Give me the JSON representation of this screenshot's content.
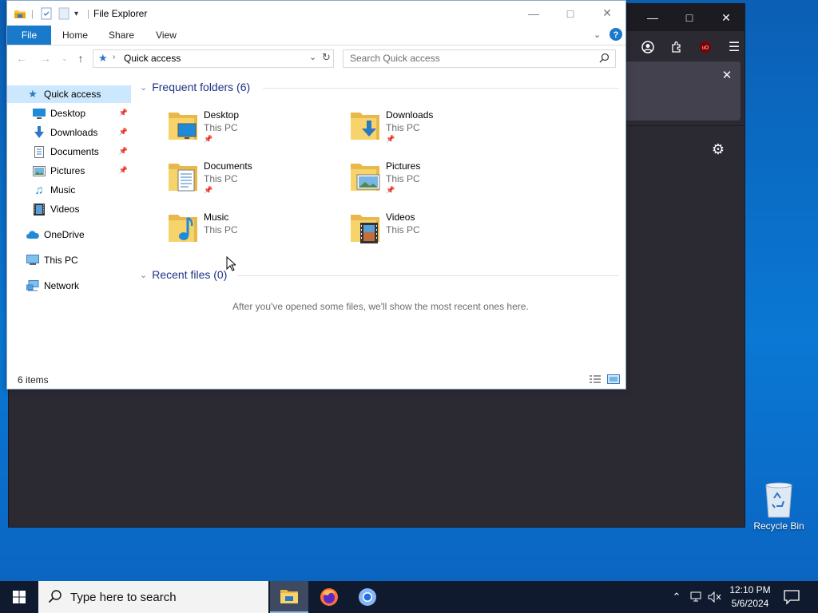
{
  "explorer": {
    "title": "File Explorer",
    "ribbon_tabs": [
      "File",
      "Home",
      "Share",
      "View"
    ],
    "address": "Quick access",
    "search_placeholder": "Search Quick access",
    "nav": {
      "quick_access": "Quick access",
      "pinned": [
        {
          "label": "Desktop",
          "icon": "desktop-icon",
          "pinned": true
        },
        {
          "label": "Downloads",
          "icon": "downloads-icon",
          "pinned": true
        },
        {
          "label": "Documents",
          "icon": "documents-icon",
          "pinned": true
        },
        {
          "label": "Pictures",
          "icon": "pictures-icon",
          "pinned": true
        },
        {
          "label": "Music",
          "icon": "music-icon",
          "pinned": false
        },
        {
          "label": "Videos",
          "icon": "videos-icon",
          "pinned": false
        }
      ],
      "onedrive": "OneDrive",
      "this_pc": "This PC",
      "network": "Network"
    },
    "frequent_heading": "Frequent folders (6)",
    "frequent": [
      {
        "name": "Desktop",
        "location": "This PC",
        "pinned": true,
        "icon": "desktop-folder-icon"
      },
      {
        "name": "Downloads",
        "location": "This PC",
        "pinned": true,
        "icon": "downloads-folder-icon"
      },
      {
        "name": "Documents",
        "location": "This PC",
        "pinned": true,
        "icon": "documents-folder-icon"
      },
      {
        "name": "Pictures",
        "location": "This PC",
        "pinned": true,
        "icon": "pictures-folder-icon"
      },
      {
        "name": "Music",
        "location": "This PC",
        "pinned": false,
        "icon": "music-folder-icon"
      },
      {
        "name": "Videos",
        "location": "This PC",
        "pinned": false,
        "icon": "videos-folder-icon"
      }
    ],
    "recent_heading": "Recent files (0)",
    "recent_empty": "After you've opened some files, we'll show the most recent ones here.",
    "status": "6 items"
  },
  "desktop": {
    "recycle_bin": "Recycle Bin"
  },
  "taskbar": {
    "search_placeholder": "Type here to search",
    "time": "12:10 PM",
    "date": "5/6/2024"
  },
  "colors": {
    "accent": "#1979ca",
    "desktop_blue": "#0a78d4",
    "browser_dark": "#2b2a33",
    "taskbar": "#0f1a2e",
    "heading_blue": "#1e3287"
  }
}
